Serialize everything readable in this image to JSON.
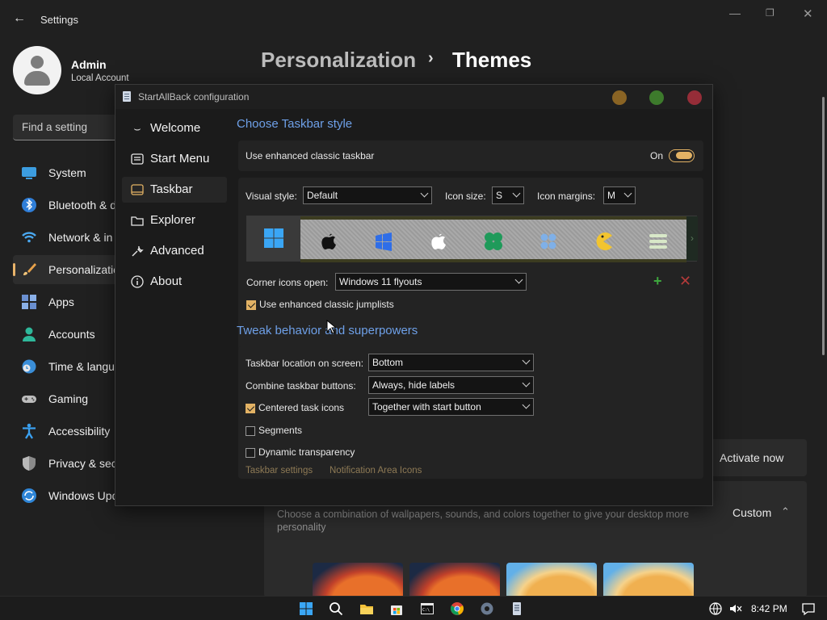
{
  "settings": {
    "window_title": "Settings",
    "user": {
      "name": "Admin",
      "account_type": "Local Account"
    },
    "search_placeholder": "Find a setting",
    "nav": [
      {
        "label": "System",
        "icon": "monitor-icon"
      },
      {
        "label": "Bluetooth & d",
        "icon": "bluetooth-icon"
      },
      {
        "label": "Network & in",
        "icon": "wifi-icon"
      },
      {
        "label": "Personalizatio",
        "icon": "brush-icon",
        "active": true
      },
      {
        "label": "Apps",
        "icon": "apps-icon"
      },
      {
        "label": "Accounts",
        "icon": "person-icon"
      },
      {
        "label": "Time & langu",
        "icon": "clock-globe-icon"
      },
      {
        "label": "Gaming",
        "icon": "gamepad-icon"
      },
      {
        "label": "Accessibility",
        "icon": "accessibility-icon"
      },
      {
        "label": "Privacy & sec",
        "icon": "shield-icon"
      },
      {
        "label": "Windows Upd",
        "icon": "update-icon"
      }
    ],
    "breadcrumb": {
      "parent": "Personalization",
      "separator": "›",
      "current": "Themes"
    },
    "activate_label": "Activate now",
    "themes_card": {
      "description": "Choose a combination of wallpapers, sounds, and colors together to give your desktop more personality",
      "current": "Custom"
    }
  },
  "dialog": {
    "title": "StartAllBack configuration",
    "sidebar": [
      {
        "label": "Welcome",
        "icon": "smile-icon"
      },
      {
        "label": "Start Menu",
        "icon": "start-menu-icon"
      },
      {
        "label": "Taskbar",
        "icon": "taskbar-icon",
        "active": true
      },
      {
        "label": "Explorer",
        "icon": "folder-icon"
      },
      {
        "label": "Advanced",
        "icon": "wrench-icon"
      },
      {
        "label": "About",
        "icon": "info-icon"
      }
    ],
    "taskbar_style": {
      "heading": "Choose Taskbar style",
      "enhanced_label": "Use enhanced classic taskbar",
      "toggle_state": "On",
      "visual_style_label": "Visual style:",
      "visual_style_value": "Default",
      "icon_size_label": "Icon size:",
      "icon_size_value": "S",
      "icon_margins_label": "Icon margins:",
      "icon_margins_value": "M",
      "corner_icons_label": "Corner icons open:",
      "corner_icons_value": "Windows 11 flyouts",
      "jumplists_label": "Use enhanced classic jumplists",
      "jumplists_checked": true
    },
    "tweak": {
      "heading": "Tweak behavior and superpowers",
      "location_label": "Taskbar location on screen:",
      "location_value": "Bottom",
      "combine_label": "Combine taskbar buttons:",
      "combine_value": "Always, hide labels",
      "centered_label": "Centered task icons",
      "centered_checked": true,
      "centered_value": "Together with start button",
      "segments_label": "Segments",
      "segments_checked": false,
      "transparency_label": "Dynamic transparency",
      "transparency_checked": false,
      "link_taskbar_settings": "Taskbar settings",
      "link_notification_icons": "Notification Area Icons"
    }
  },
  "taskbar": {
    "time": "8:42 PM"
  },
  "colors": {
    "accent": "#e2b264",
    "heading_blue": "#6ea0e8"
  }
}
